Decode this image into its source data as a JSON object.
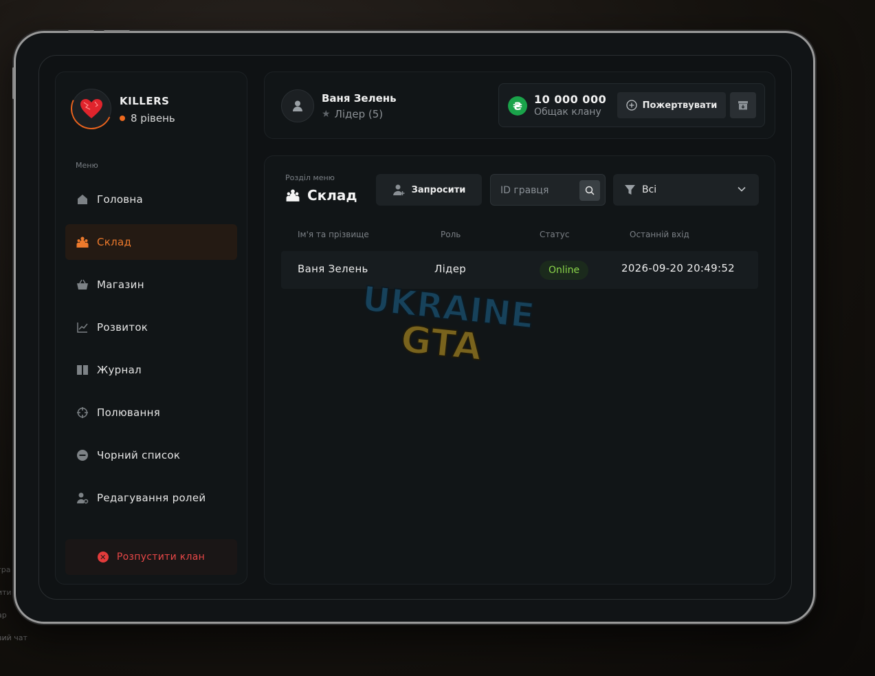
{
  "background_overlay": {
    "lines": [
      "гра",
      "ити з",
      "ар",
      "вий чат"
    ]
  },
  "clan": {
    "name": "KILLERS",
    "level": "8 рівень"
  },
  "sidebar": {
    "menu_label": "Меню",
    "items": [
      {
        "label": "Головна",
        "icon": "home-icon"
      },
      {
        "label": "Склад",
        "icon": "members-icon",
        "active": true
      },
      {
        "label": "Магазин",
        "icon": "shop-basket-icon"
      },
      {
        "label": "Розвиток",
        "icon": "chart-line-icon"
      },
      {
        "label": "Журнал",
        "icon": "book-icon"
      },
      {
        "label": "Полювання",
        "icon": "crosshair-icon"
      },
      {
        "label": "Чорний список",
        "icon": "minus-circle-icon"
      },
      {
        "label": "Редагування ролей",
        "icon": "user-settings-icon"
      }
    ],
    "dissolve_label": "Розпустити клан"
  },
  "header": {
    "user_name": "Ваня Зелень",
    "user_role": "Лідер (5)",
    "bank_amount": "10 000 000",
    "bank_label": "Общак клану",
    "donate_label": "Пожертвувати"
  },
  "section": {
    "label": "Розділ меню",
    "title": "Склад",
    "invite_label": "Запросити",
    "search_placeholder": "ID гравця",
    "filter_value": "Всі"
  },
  "table": {
    "headers": [
      "Ім'я та прізвище",
      "Роль",
      "Статус",
      "Останній вхід"
    ],
    "rows": [
      {
        "name": "Ваня Зелень",
        "role": "Лідер",
        "status": "Online",
        "last_login": "2026-09-20 20:49:52"
      }
    ]
  },
  "watermark": {
    "line1": "UKRAINE",
    "line2": "GTA"
  },
  "colors": {
    "accent": "#ee7a2c",
    "online": "#8bd64a",
    "danger": "#e23b3b",
    "money": "#1aa34a"
  }
}
